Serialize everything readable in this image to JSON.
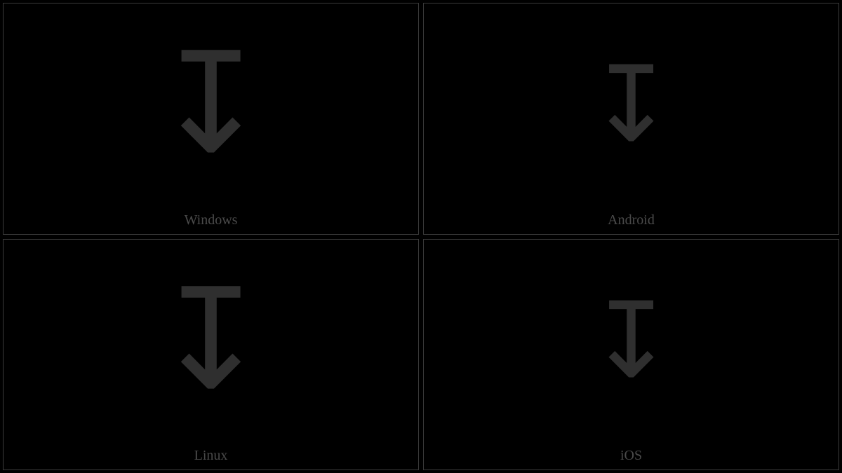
{
  "cells": [
    {
      "label": "Windows",
      "glyph": "↧"
    },
    {
      "label": "Android",
      "glyph": "↧"
    },
    {
      "label": "Linux",
      "glyph": "↧"
    },
    {
      "label": "iOS",
      "glyph": "↧"
    }
  ]
}
